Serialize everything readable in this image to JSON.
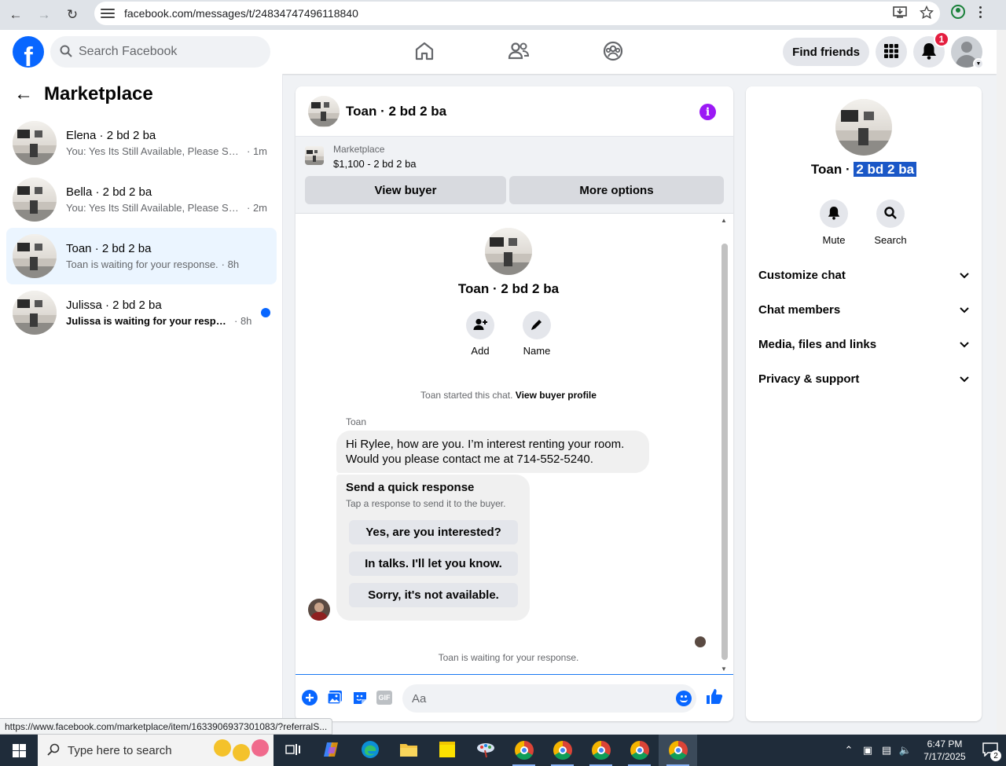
{
  "browser": {
    "url": "facebook.com/messages/t/24834747496118840"
  },
  "topnav": {
    "search_placeholder": "Search Facebook",
    "find_friends": "Find friends",
    "notification_count": "1"
  },
  "sidebar": {
    "title": "Marketplace",
    "chats": [
      {
        "name": "Elena · 2 bd 2 ba",
        "preview": "You: Yes Its Still Available, Please Sen...",
        "time": "· 1m",
        "unread": false,
        "active": false
      },
      {
        "name": "Bella · 2 bd 2 ba",
        "preview": "You: Yes Its Still Available, Please Sen...",
        "time": "· 2m",
        "unread": false,
        "active": false
      },
      {
        "name": "Toan · 2 bd 2 ba",
        "preview": "Toan is waiting for your response.",
        "time": "· 8h",
        "unread": false,
        "active": true
      },
      {
        "name": "Julissa · 2 bd 2 ba",
        "preview": "Julissa is waiting for your response.",
        "time": "· 8h",
        "unread": true,
        "active": false
      }
    ]
  },
  "conversation": {
    "title": "Toan · 2 bd 2 ba",
    "marketplace_label": "Marketplace",
    "listing": "$1,100 - 2 bd 2 ba",
    "view_buyer": "View buyer",
    "more_options": "More options",
    "profile_name": "Toan · 2 bd 2 ba",
    "add_label": "Add",
    "name_label": "Name",
    "started_text": "Toan started this chat.",
    "view_buyer_profile": "View buyer profile",
    "sender": "Toan",
    "message_line1": "Hi Rylee, how are you. I’m interest renting your room.",
    "message_line2": "Would you please contact me at 714-552-5240.",
    "quick_title": "Send a quick response",
    "quick_sub": "Tap a response to send it to the buyer.",
    "quick_replies": [
      "Yes, are you interested?",
      "In talks. I'll let you know.",
      "Sorry, it's not available."
    ],
    "waiting": "Toan is waiting for your response.",
    "composer_placeholder": "Aa",
    "gif_label": "GIF"
  },
  "info_panel": {
    "name_first": "Toan · ",
    "name_selected": "2 bd 2 ba",
    "mute": "Mute",
    "search": "Search",
    "sections": [
      "Customize chat",
      "Chat members",
      "Media, files and links",
      "Privacy & support"
    ]
  },
  "status_url": "https://www.facebook.com/marketplace/item/1633906937301083/?referralS...",
  "taskbar": {
    "search_placeholder": "Type here to search",
    "time": "6:47 PM",
    "date": "7/17/2025",
    "notification_count": "2"
  },
  "colors": {
    "brand": "#0866ff",
    "active_chat": "#ebf5ff",
    "info_purple": "#9b19f5",
    "selection": "#1a57c7"
  }
}
